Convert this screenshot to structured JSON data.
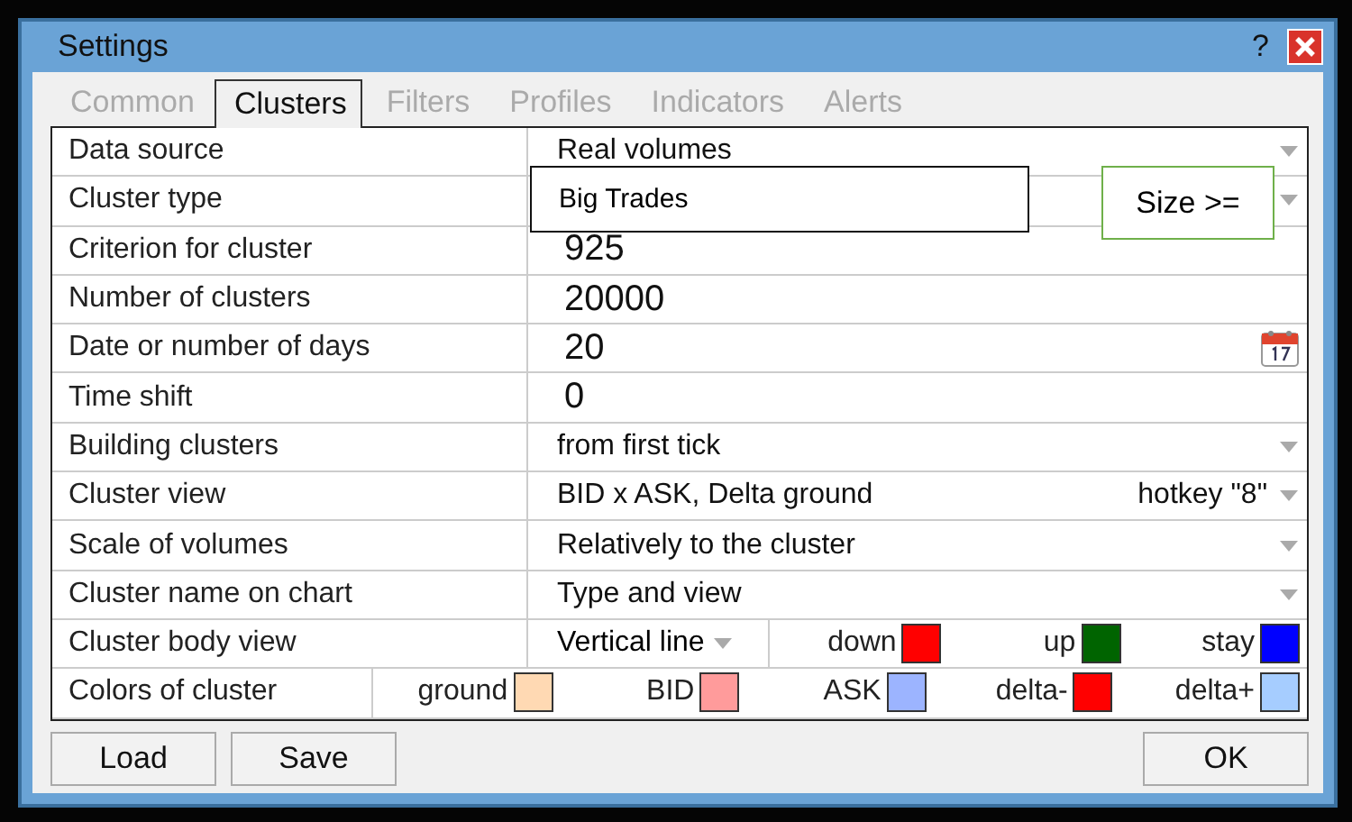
{
  "window": {
    "title": "Settings",
    "help": "?"
  },
  "tabs": [
    {
      "label": "Common",
      "selected": false
    },
    {
      "label": "Clusters",
      "selected": true
    },
    {
      "label": "Filters",
      "selected": false
    },
    {
      "label": "Profiles",
      "selected": false
    },
    {
      "label": "Indicators",
      "selected": false
    },
    {
      "label": "Alerts",
      "selected": false
    }
  ],
  "rows": [
    {
      "kind": "dropdown",
      "label": "Data source",
      "value": "Real volumes"
    },
    {
      "kind": "dropdown",
      "label": "Cluster type"
    },
    {
      "kind": "text",
      "label": "Criterion for cluster",
      "value": "925"
    },
    {
      "kind": "text",
      "label": "Number of clusters",
      "value": "20000"
    },
    {
      "kind": "date",
      "label": "Date or number of days",
      "value": "20"
    },
    {
      "kind": "text",
      "label": "Time shift",
      "value": "0"
    },
    {
      "kind": "dropdown",
      "label": "Building clusters",
      "value": "from first tick"
    },
    {
      "kind": "dropdown",
      "label": "Cluster view",
      "value": "BID x ASK, Delta ground",
      "hint": "hotkey \"8\""
    },
    {
      "kind": "dropdown",
      "label": "Scale of volumes",
      "value": "Relatively to the cluster"
    },
    {
      "kind": "dropdown",
      "label": "Cluster name on chart",
      "value": "Type and view"
    },
    {
      "kind": "body",
      "label": "Cluster body view",
      "value": "Vertical line",
      "swatches": [
        {
          "label": "down",
          "color": "#ff0000"
        },
        {
          "label": "up",
          "color": "#006400"
        },
        {
          "label": "stay",
          "color": "#0000ff"
        }
      ]
    },
    {
      "kind": "colors",
      "label": "Colors of cluster",
      "swatches": [
        {
          "label": "ground",
          "color": "#ffd9b3"
        },
        {
          "label": "BID",
          "color": "#ff9b9b"
        },
        {
          "label": "ASK",
          "color": "#9cb4ff"
        },
        {
          "label": "delta-",
          "color": "#ff0000"
        },
        {
          "label": "delta+",
          "color": "#a6cdff"
        }
      ]
    }
  ],
  "overlays": [
    {
      "kind": "box",
      "text": "Big Trades"
    },
    {
      "kind": "tag",
      "text": "Size >="
    }
  ],
  "buttons": [
    {
      "label": "Load"
    },
    {
      "label": "Save"
    },
    {
      "label": "OK"
    }
  ]
}
